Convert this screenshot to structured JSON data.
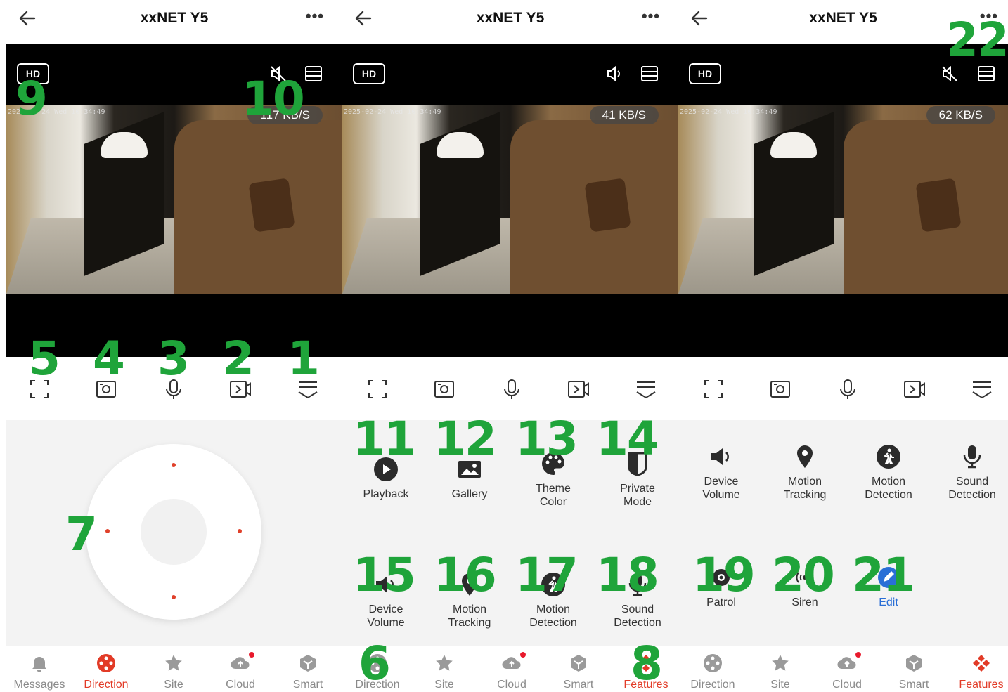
{
  "app": {
    "title": "xxNET Y5",
    "more_label": "•••"
  },
  "colors": {
    "accent": "#e23b27",
    "annotation": "#1fa43a",
    "edit_blue": "#2a6fd6"
  },
  "video": {
    "hd_label": "HD",
    "timestamp": "2025-02-24 Wed 10:34:49",
    "panels": [
      {
        "rate": "117 KB/S",
        "mute_icon": "speaker-muted-icon"
      },
      {
        "rate": "41 KB/S",
        "mute_icon": "speaker-on-icon"
      },
      {
        "rate": "62 KB/S",
        "mute_icon": "speaker-muted-icon"
      }
    ]
  },
  "toolbar": [
    "fullscreen-icon",
    "screenshot-icon",
    "microphone-icon",
    "record-icon",
    "expand-icon"
  ],
  "features_page1": [
    {
      "label": "Playback"
    },
    {
      "label": "Gallery"
    },
    {
      "label": "Theme\nColor"
    },
    {
      "label": "Private\nMode"
    },
    {
      "label": "Device\nVolume"
    },
    {
      "label": "Motion\nTracking"
    },
    {
      "label": "Motion\nDetection"
    },
    {
      "label": "Sound\nDetection"
    }
  ],
  "features_page2": [
    {
      "label": "Device\nVolume"
    },
    {
      "label": "Motion\nTracking"
    },
    {
      "label": "Motion\nDetection"
    },
    {
      "label": "Sound\nDetection"
    },
    {
      "label": "Patrol"
    },
    {
      "label": "Siren"
    },
    {
      "label": "Edit"
    }
  ],
  "nav": {
    "panel0": [
      "Messages",
      "Direction",
      "Site",
      "Cloud",
      "Smart"
    ],
    "panel1": [
      "Direction",
      "Site",
      "Cloud",
      "Smart",
      "Features"
    ],
    "panel2": [
      "Direction",
      "Site",
      "Cloud",
      "Smart",
      "Features"
    ]
  },
  "annotations": [
    "1",
    "2",
    "3",
    "4",
    "5",
    "6",
    "7",
    "8",
    "9",
    "10",
    "11",
    "12",
    "13",
    "14",
    "15",
    "16",
    "17",
    "18",
    "19",
    "20",
    "21",
    "22"
  ]
}
